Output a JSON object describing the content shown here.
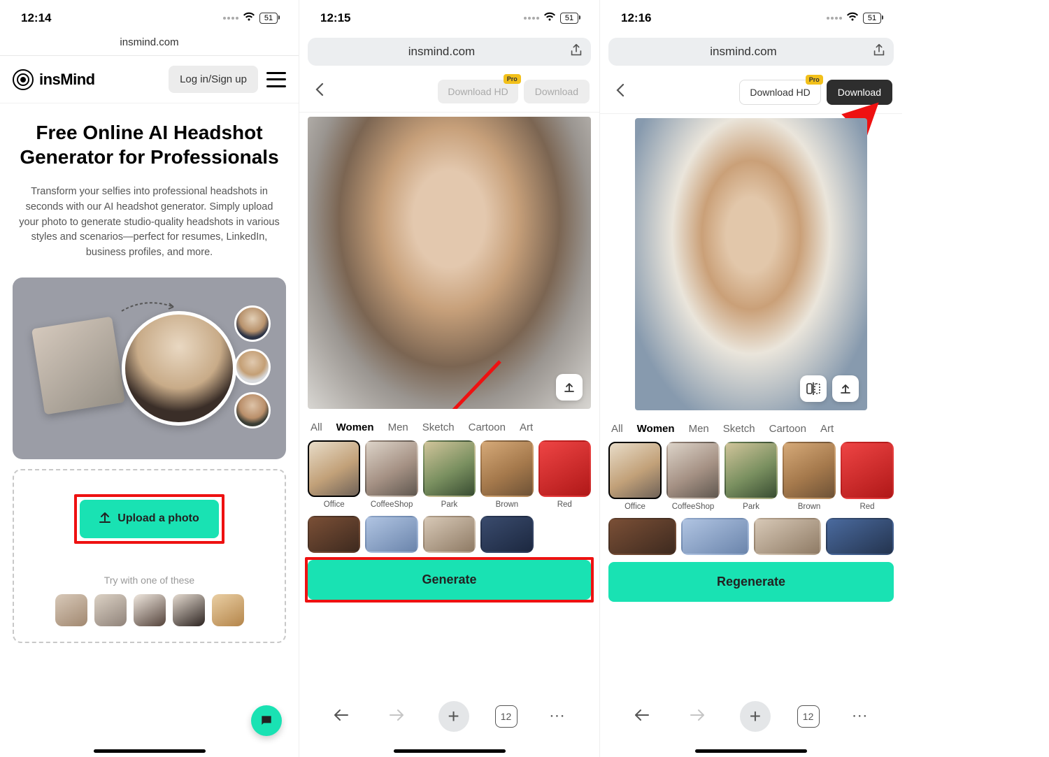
{
  "screen1": {
    "status": {
      "time": "12:14",
      "battery": "51"
    },
    "url": "insmind.com",
    "logo_text": "insMind",
    "login_label": "Log in/Sign up",
    "hero_title": "Free Online AI Headshot Generator for Professionals",
    "hero_desc": "Transform your selfies into professional headshots in seconds with our AI headshot generator. Simply upload your photo to generate studio-quality headshots in various styles and scenarios—perfect for resumes, LinkedIn, business profiles, and more.",
    "upload_label": "Upload a photo",
    "try_text": "Try with one of these"
  },
  "screen2": {
    "status": {
      "time": "12:15",
      "battery": "51"
    },
    "url": "insmind.com",
    "download_hd": "Download HD",
    "download": "Download",
    "pro": "Pro",
    "tabs": [
      "All",
      "Women",
      "Men",
      "Sketch",
      "Cartoon",
      "Art"
    ],
    "active_tab": "Women",
    "styles": [
      "Office",
      "CoffeeShop",
      "Park",
      "Brown",
      "Red"
    ],
    "generate_label": "Generate",
    "tab_count": "12"
  },
  "screen3": {
    "status": {
      "time": "12:16",
      "battery": "51"
    },
    "url": "insmind.com",
    "download_hd": "Download HD",
    "download": "Download",
    "pro": "Pro",
    "tabs": [
      "All",
      "Women",
      "Men",
      "Sketch",
      "Cartoon",
      "Art"
    ],
    "active_tab": "Women",
    "styles": [
      "Office",
      "CoffeeShop",
      "Park",
      "Brown",
      "Red"
    ],
    "regenerate_label": "Regenerate",
    "tab_count": "12"
  }
}
